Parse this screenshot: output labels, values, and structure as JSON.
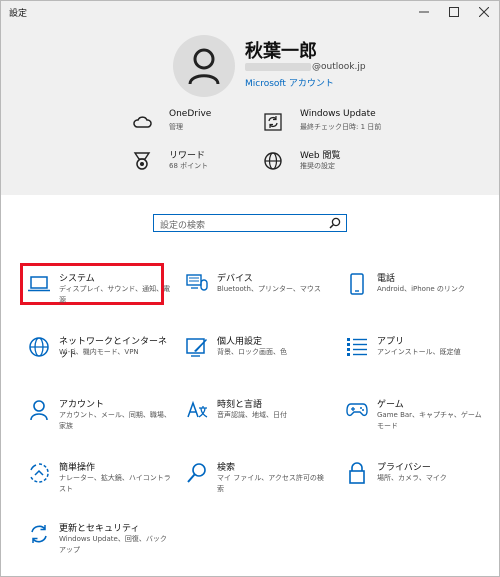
{
  "window": {
    "title": "設定"
  },
  "account": {
    "name": "秋葉一郎",
    "email_visible": "@outlook.jp",
    "ms_account_link": "Microsoft アカウント"
  },
  "quick": [
    {
      "title": "OneDrive",
      "subtitle": "管理",
      "icon": "cloud-icon"
    },
    {
      "title": "Windows Update",
      "subtitle": "最終チェック日時: 1 日前",
      "icon": "update-icon"
    },
    {
      "title": "リワード",
      "subtitle": "68 ポイント",
      "icon": "rewards-icon"
    },
    {
      "title": "Web 閲覧",
      "subtitle": "推奨の設定",
      "icon": "globe-icon"
    }
  ],
  "search": {
    "placeholder": "設定の検索"
  },
  "tiles": [
    {
      "title": "システム",
      "subtitle": "ディスプレイ、サウンド、通知、電源",
      "icon": "laptop-icon"
    },
    {
      "title": "デバイス",
      "subtitle": "Bluetooth、プリンター、マウス",
      "icon": "devices-icon"
    },
    {
      "title": "電話",
      "subtitle": "Android、iPhone のリンク",
      "icon": "phone-icon"
    },
    {
      "title": "ネットワークとインターネット",
      "subtitle": "Wi-Fi、機内モード、VPN",
      "icon": "network-globe-icon"
    },
    {
      "title": "個人用設定",
      "subtitle": "背景、ロック画面、色",
      "icon": "personalization-icon"
    },
    {
      "title": "アプリ",
      "subtitle": "アンインストール、既定値",
      "icon": "apps-list-icon"
    },
    {
      "title": "アカウント",
      "subtitle": "アカウント、メール、同期、職場、家族",
      "icon": "account-icon"
    },
    {
      "title": "時刻と言語",
      "subtitle": "音声認識、地域、日付",
      "icon": "time-language-icon"
    },
    {
      "title": "ゲーム",
      "subtitle": "Game Bar、キャプチャ、ゲーム モード",
      "icon": "gamepad-icon"
    },
    {
      "title": "簡単操作",
      "subtitle": "ナレーター、拡大鏡、ハイコントラスト",
      "icon": "ease-of-access-icon"
    },
    {
      "title": "検索",
      "subtitle": "マイ ファイル、アクセス許可の検索",
      "icon": "search-icon"
    },
    {
      "title": "プライバシー",
      "subtitle": "場所、カメラ、マイク",
      "icon": "lock-icon"
    },
    {
      "title": "更新とセキュリティ",
      "subtitle": "Windows Update、回復、バックアップ",
      "icon": "sync-icon"
    }
  ],
  "colors": {
    "accent": "#0067c0",
    "highlight": "#e81123",
    "header_bg": "#f0f0f0"
  }
}
